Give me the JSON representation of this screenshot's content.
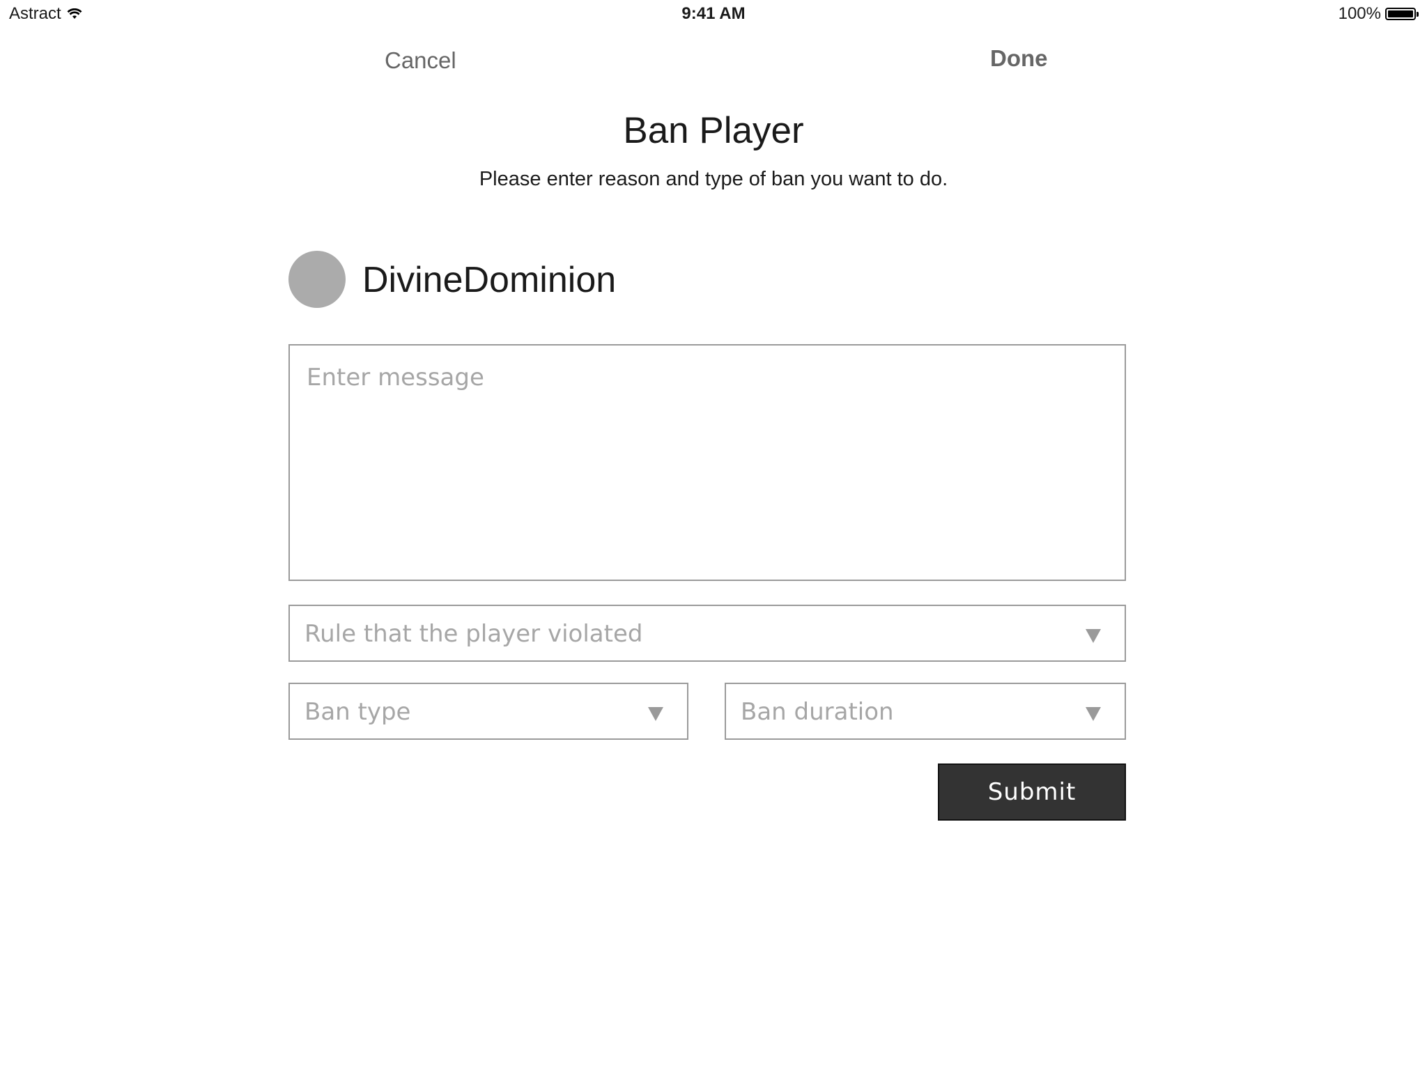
{
  "status_bar": {
    "carrier": "Astract",
    "time": "9:41 AM",
    "battery_percent": "100%",
    "battery_level": 1.0,
    "icons": [
      "wifi-icon",
      "battery-icon"
    ]
  },
  "nav": {
    "cancel_label": "Cancel",
    "done_label": "Done"
  },
  "header": {
    "title": "Ban Player",
    "subtitle": "Please enter reason and type of ban you want to do."
  },
  "player": {
    "name": "DivineDominion",
    "avatar_color": "#ababab"
  },
  "form": {
    "message_placeholder": "Enter message",
    "message_value": "",
    "rule_placeholder": "Rule that the player violated",
    "ban_type_placeholder": "Ban type",
    "ban_duration_placeholder": "Ban duration",
    "submit_label": "Submit"
  },
  "colors": {
    "submit_background": "#333333",
    "nav_text": "#666666",
    "placeholder_text": "#a6a6a6",
    "field_border": "#9a9a9a"
  }
}
